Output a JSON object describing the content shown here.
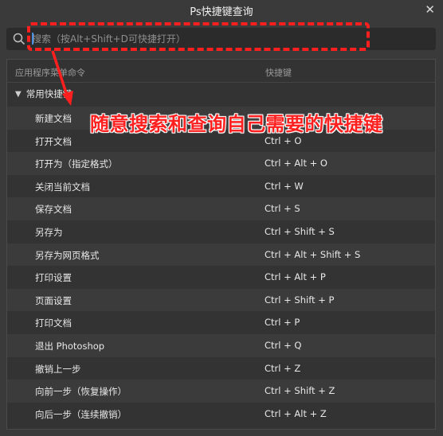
{
  "window": {
    "title": "Ps快捷键查询",
    "close_glyph": "✕"
  },
  "search": {
    "placeholder": "搜索（按Alt+Shift+D可快捷打开）",
    "icon": "search-icon"
  },
  "table": {
    "col_command": "应用程序菜单命令",
    "col_shortcut": "快捷键",
    "group": {
      "label": "常用快捷键",
      "icon": "chevron-down-icon"
    },
    "rows": [
      {
        "command": "新建文档",
        "shortcut": ""
      },
      {
        "command": "打开文档",
        "shortcut": "Ctrl + O"
      },
      {
        "command": "打开为（指定格式）",
        "shortcut": "Ctrl + Alt + O"
      },
      {
        "command": "关闭当前文档",
        "shortcut": "Ctrl + W"
      },
      {
        "command": "保存文档",
        "shortcut": "Ctrl + S"
      },
      {
        "command": "另存为",
        "shortcut": "Ctrl + Shift + S"
      },
      {
        "command": "另存为网页格式",
        "shortcut": "Ctrl + Alt + Shift + S"
      },
      {
        "command": "打印设置",
        "shortcut": "Ctrl + Alt + P"
      },
      {
        "command": "页面设置",
        "shortcut": "Ctrl + Shift + P"
      },
      {
        "command": "打印文档",
        "shortcut": "Ctrl + P"
      },
      {
        "command": "退出 Photoshop",
        "shortcut": "Ctrl + Q"
      },
      {
        "command": "撤销上一步",
        "shortcut": "Ctrl + Z"
      },
      {
        "command": "向前一步（恢复操作）",
        "shortcut": "Ctrl + Shift + Z"
      },
      {
        "command": "向后一步（连续撤销）",
        "shortcut": "Ctrl + Alt + Z"
      }
    ]
  },
  "annotation": {
    "text": "随意搜索和查询自己需要的快捷键",
    "color": "#ff2020"
  },
  "colors": {
    "background": "#3a3a3a",
    "accent_red": "#ff1f1f",
    "caret": "#4a8fe0"
  }
}
